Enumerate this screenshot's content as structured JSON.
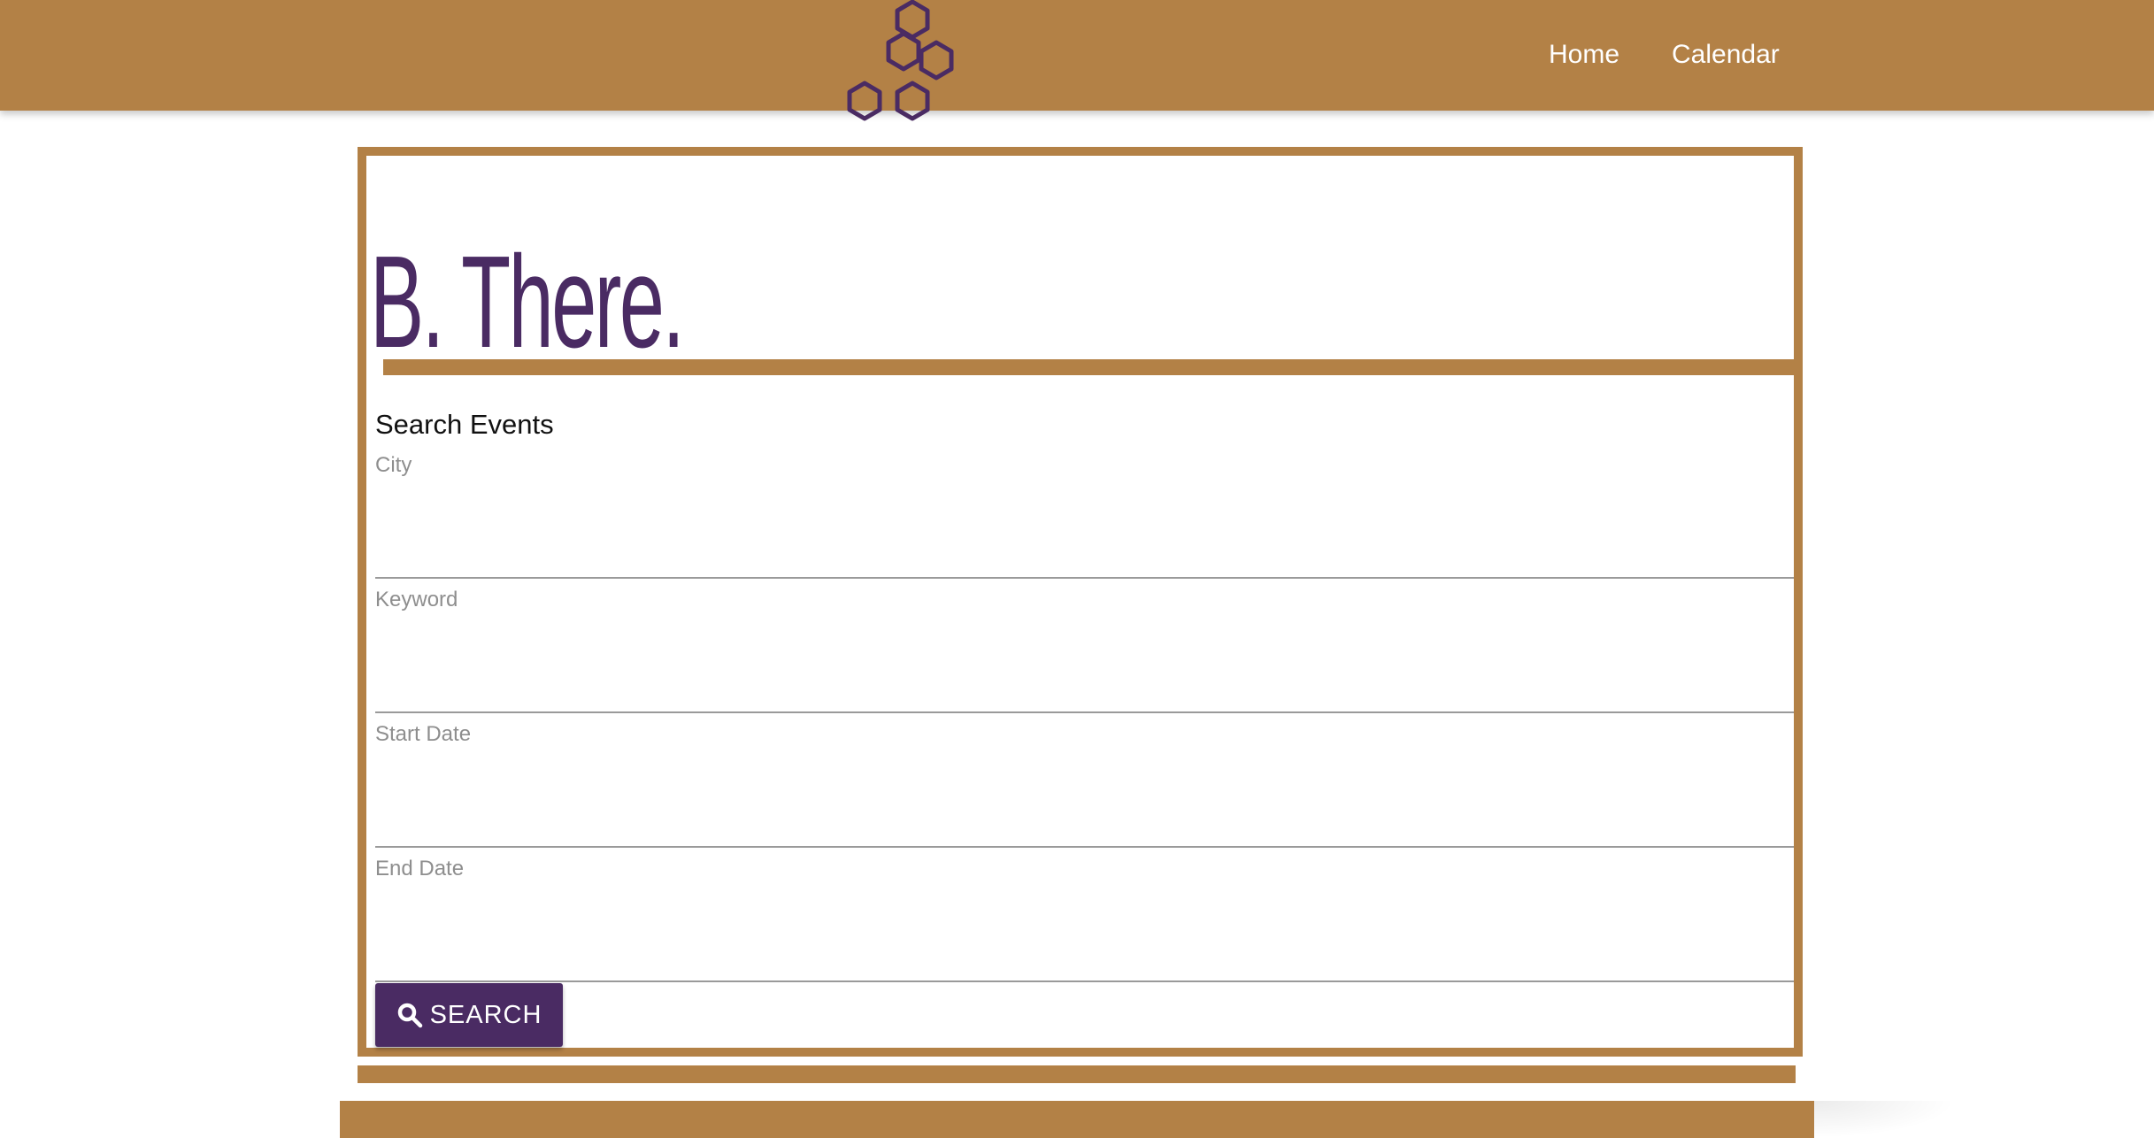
{
  "nav": {
    "links": [
      {
        "label": "Home"
      },
      {
        "label": "Calendar"
      }
    ],
    "logo_icon": "honeycomb-icon"
  },
  "brand": {
    "title": "B. There."
  },
  "search": {
    "heading": "Search Events",
    "fields": [
      {
        "label": "City",
        "value": ""
      },
      {
        "label": "Keyword",
        "value": ""
      },
      {
        "label": "Start Date",
        "value": ""
      },
      {
        "label": "End Date",
        "value": ""
      }
    ],
    "button_label": "SEARCH",
    "button_icon": "search-icon"
  },
  "colors": {
    "primary_gold": "#b38146",
    "accent_purple": "#4a2b63"
  }
}
